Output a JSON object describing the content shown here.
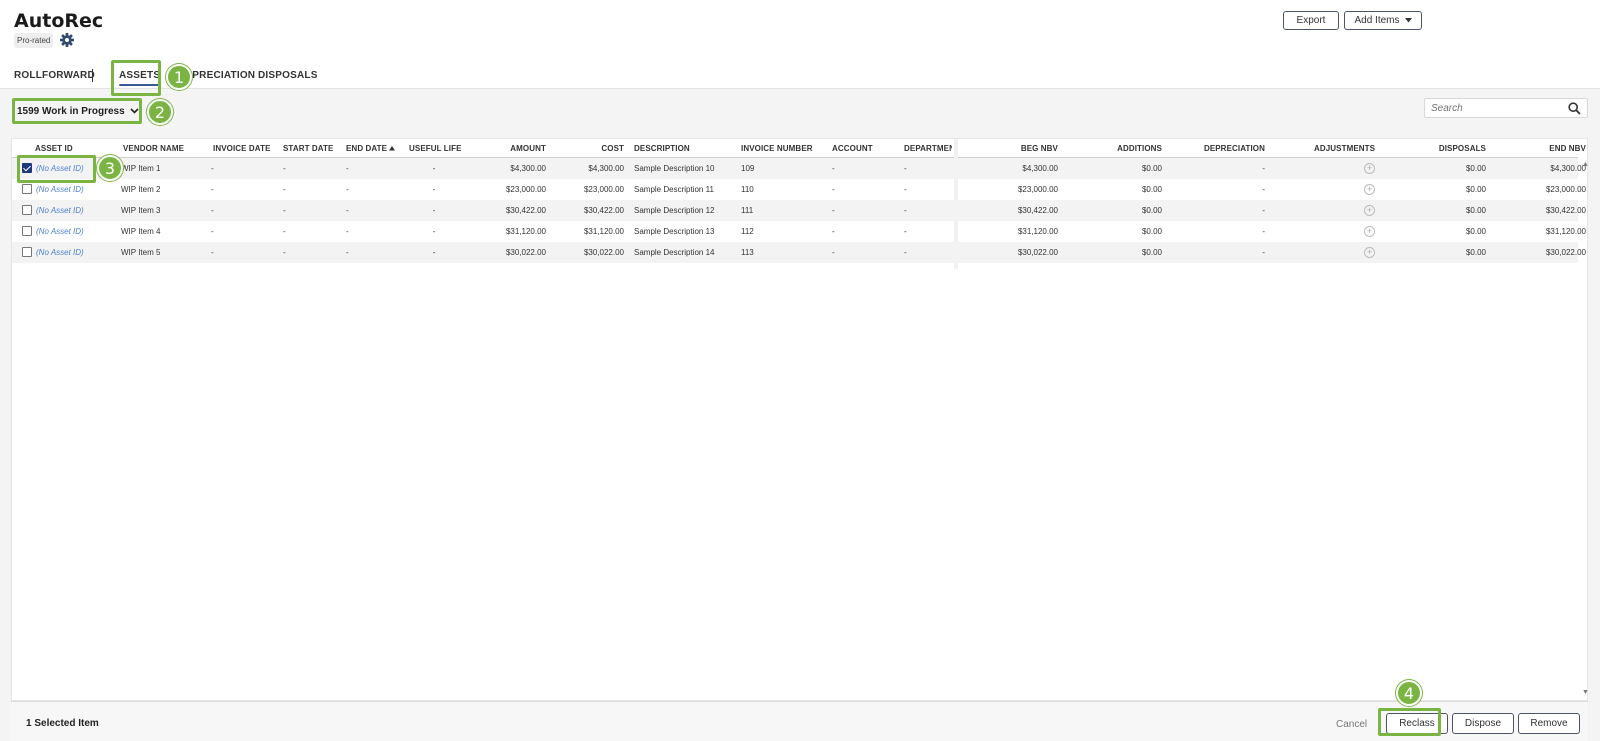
{
  "app": {
    "title": "AutoRec",
    "badge": "Pro-rated"
  },
  "toolbar": {
    "export_label": "Export",
    "add_items_label": "Add Items"
  },
  "tabs": [
    {
      "label": "ROLLFORWARD"
    },
    {
      "label": "ASSETS"
    },
    {
      "label": "DEPRECIATION"
    },
    {
      "label": "DISPOSALS"
    }
  ],
  "account_select": {
    "value": "1599 Work in Progress"
  },
  "search": {
    "placeholder": "Search"
  },
  "columns": [
    "ASSET ID",
    "VENDOR NAME",
    "INVOICE DATE",
    "START DATE",
    "END DATE",
    "USEFUL LIFE",
    "AMOUNT",
    "COST",
    "DESCRIPTION",
    "INVOICE NUMBER",
    "ACCOUNT",
    "DEPARTMEN",
    "BEG NBV",
    "ADDITIONS",
    "DEPRECIATION",
    "ADJUSTMENTS",
    "DISPOSALS",
    "END NBV"
  ],
  "rows": [
    {
      "checked": true,
      "cells": [
        "(No Asset ID)",
        "WIP Item 1",
        "-",
        "-",
        "-",
        "-",
        "$4,300.00",
        "$4,300.00",
        "Sample Description 10",
        "109",
        "-",
        "-",
        "$4,300.00",
        "$0.00",
        "-",
        "",
        "$0.00",
        "$4,300.00"
      ]
    },
    {
      "checked": false,
      "cells": [
        "(No Asset ID)",
        "WIP Item 2",
        "-",
        "-",
        "-",
        "-",
        "$23,000.00",
        "$23,000.00",
        "Sample Description 11",
        "110",
        "-",
        "-",
        "$23,000.00",
        "$0.00",
        "-",
        "",
        "$0.00",
        "$23,000.00"
      ]
    },
    {
      "checked": false,
      "cells": [
        "(No Asset ID)",
        "WIP Item 3",
        "-",
        "-",
        "-",
        "-",
        "$30,422.00",
        "$30,422.00",
        "Sample Description 12",
        "111",
        "-",
        "-",
        "$30,422.00",
        "$0.00",
        "-",
        "",
        "$0.00",
        "$30,422.00"
      ]
    },
    {
      "checked": false,
      "cells": [
        "(No Asset ID)",
        "WIP Item 4",
        "-",
        "-",
        "-",
        "-",
        "$31,120.00",
        "$31,120.00",
        "Sample Description 13",
        "112",
        "-",
        "-",
        "$31,120.00",
        "$0.00",
        "-",
        "",
        "$0.00",
        "$31,120.00"
      ]
    },
    {
      "checked": false,
      "cells": [
        "(No Asset ID)",
        "WIP Item 5",
        "-",
        "-",
        "-",
        "-",
        "$30,022.00",
        "$30,022.00",
        "Sample Description 14",
        "113",
        "-",
        "-",
        "$30,022.00",
        "$0.00",
        "-",
        "",
        "$0.00",
        "$30,022.00"
      ]
    }
  ],
  "footer": {
    "selected_count": "1 Selected Item",
    "cancel_label": "Cancel",
    "reclass_label": "Reclass",
    "dispose_label": "Dispose",
    "remove_label": "Remove"
  },
  "callouts": [
    "1",
    "2",
    "3",
    "4"
  ],
  "colors": {
    "callout": "#7ab543",
    "tab_underline": "#3b5a9a",
    "link": "#4e7fd0",
    "checkbox": "#1d3a7a"
  },
  "icons": {
    "settings": "gear-icon",
    "dropdown": "chevron-down-icon",
    "search": "search-icon",
    "sort": "sort-ascending-icon",
    "adjust": "plus-circle-icon"
  }
}
